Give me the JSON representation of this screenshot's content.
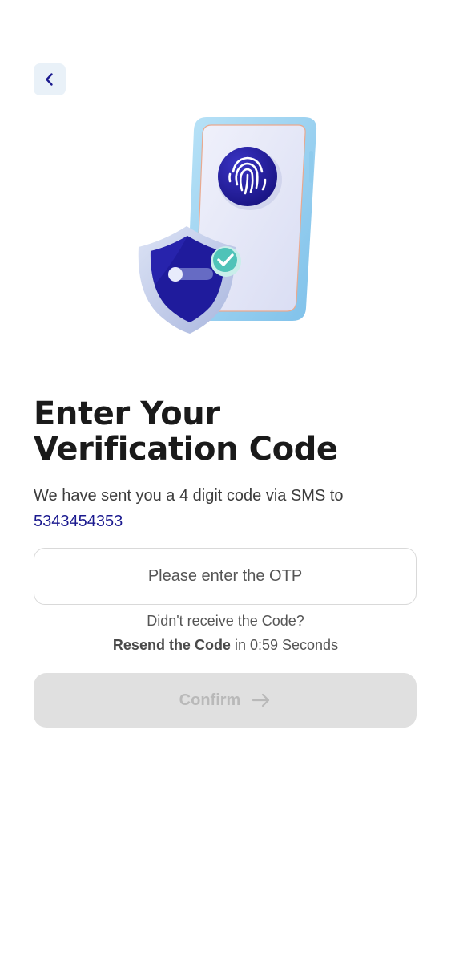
{
  "header": {
    "back_icon": "chevron-left-icon"
  },
  "illustration": {
    "name": "phone-fingerprint-shield-illustration",
    "colors": {
      "phone_frame": "#9fd3f2",
      "phone_screen": "#e4e7f7",
      "fingerprint_circle": "#1f1b9c",
      "shield": "#1f1b9c",
      "check_badge": "#4fc3b8"
    }
  },
  "main": {
    "title": "Enter Your Verification Code",
    "subtitle_prefix": "We have sent  you a  4 digit code via SMS to",
    "phone_number": "5343454353",
    "otp": {
      "value": "",
      "placeholder": "Please enter the OTP"
    },
    "resend_question": "Didn't receive the Code?",
    "resend_link": "Resend the Code",
    "resend_suffix": "in 0:59 Seconds",
    "confirm_label": "Confirm",
    "confirm_icon": "arrow-right-icon"
  },
  "colors": {
    "accent": "#1b1a8f",
    "back_button_bg": "#e9f1f8",
    "confirm_disabled_bg": "#e0e0e0",
    "confirm_disabled_text": "#b9b9b9"
  }
}
